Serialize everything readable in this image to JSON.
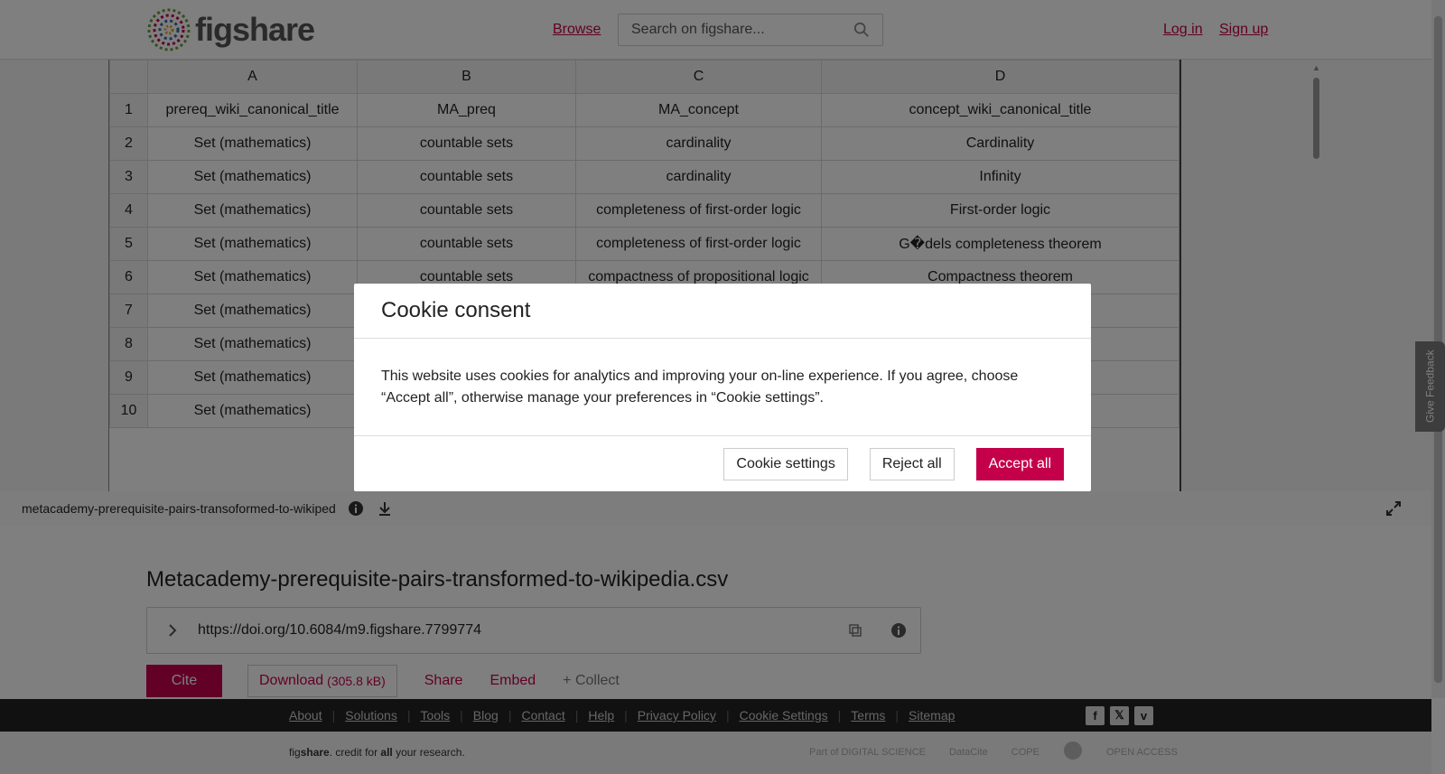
{
  "header": {
    "logo_text": "figshare",
    "browse_label": "Browse",
    "search_placeholder": "Search on figshare...",
    "login_label": "Log in",
    "signup_label": "Sign up"
  },
  "grid": {
    "columns": [
      "A",
      "B",
      "C",
      "D"
    ],
    "rows": [
      {
        "n": "1",
        "cells": [
          "prereq_wiki_canonical_title",
          "MA_preq",
          "MA_concept",
          "concept_wiki_canonical_title"
        ]
      },
      {
        "n": "2",
        "cells": [
          "Set (mathematics)",
          "countable sets",
          "cardinality",
          "Cardinality"
        ]
      },
      {
        "n": "3",
        "cells": [
          "Set (mathematics)",
          "countable sets",
          "cardinality",
          "Infinity"
        ]
      },
      {
        "n": "4",
        "cells": [
          "Set (mathematics)",
          "countable sets",
          "completeness of first-order logic",
          "First-order logic"
        ]
      },
      {
        "n": "5",
        "cells": [
          "Set (mathematics)",
          "countable sets",
          "completeness of first-order logic",
          "G�dels completeness theorem"
        ]
      },
      {
        "n": "6",
        "cells": [
          "Set (mathematics)",
          "countable sets",
          "compactness of propositional logic",
          "Compactness theorem"
        ]
      },
      {
        "n": "7",
        "cells": [
          "Set (mathematics)",
          "",
          "",
          ""
        ]
      },
      {
        "n": "8",
        "cells": [
          "Set (mathematics)",
          "",
          "",
          ""
        ]
      },
      {
        "n": "9",
        "cells": [
          "Set (mathematics)",
          "",
          "",
          ""
        ]
      },
      {
        "n": "10",
        "cells": [
          "Set (mathematics)",
          "",
          "",
          ""
        ]
      }
    ]
  },
  "file_bar": {
    "filename": "metacademy-prerequisite-pairs-transoformed-to-wikiped"
  },
  "item": {
    "title": "Metacademy-prerequisite-pairs-transformed-to-wikipedia.csv",
    "doi_url": "https://doi.org/10.6084/m9.figshare.7799774",
    "cite_label": "Cite",
    "download_label": "Download",
    "download_size": "(305.8 kB)",
    "share_label": "Share",
    "embed_label": "Embed",
    "collect_label": "+ Collect"
  },
  "footer": {
    "links": [
      "About",
      "Solutions",
      "Tools",
      "Blog",
      "Contact",
      "Help",
      "Privacy Policy",
      "Cookie Settings",
      "Terms",
      "Sitemap"
    ],
    "tagline_brand_a": "fig",
    "tagline_brand_b": "share",
    "tagline_mid": ". credit for ",
    "tagline_all": "all",
    "tagline_end": " your research.",
    "partners": [
      "Part of DIGITAL SCIENCE",
      "DataCite",
      "COPE",
      "",
      "OPEN ACCESS"
    ]
  },
  "feedback_label": "Give Feedback",
  "cookie_modal": {
    "title": "Cookie consent",
    "body": "This website uses cookies for analytics and improving your on-line experience. If you agree, choose “Accept all”, otherwise manage your preferences in “Cookie settings”.",
    "settings_label": "Cookie settings",
    "reject_label": "Reject all",
    "accept_label": "Accept all"
  },
  "colors": {
    "brand": "#c4004a",
    "footer_dark": "#222222"
  }
}
